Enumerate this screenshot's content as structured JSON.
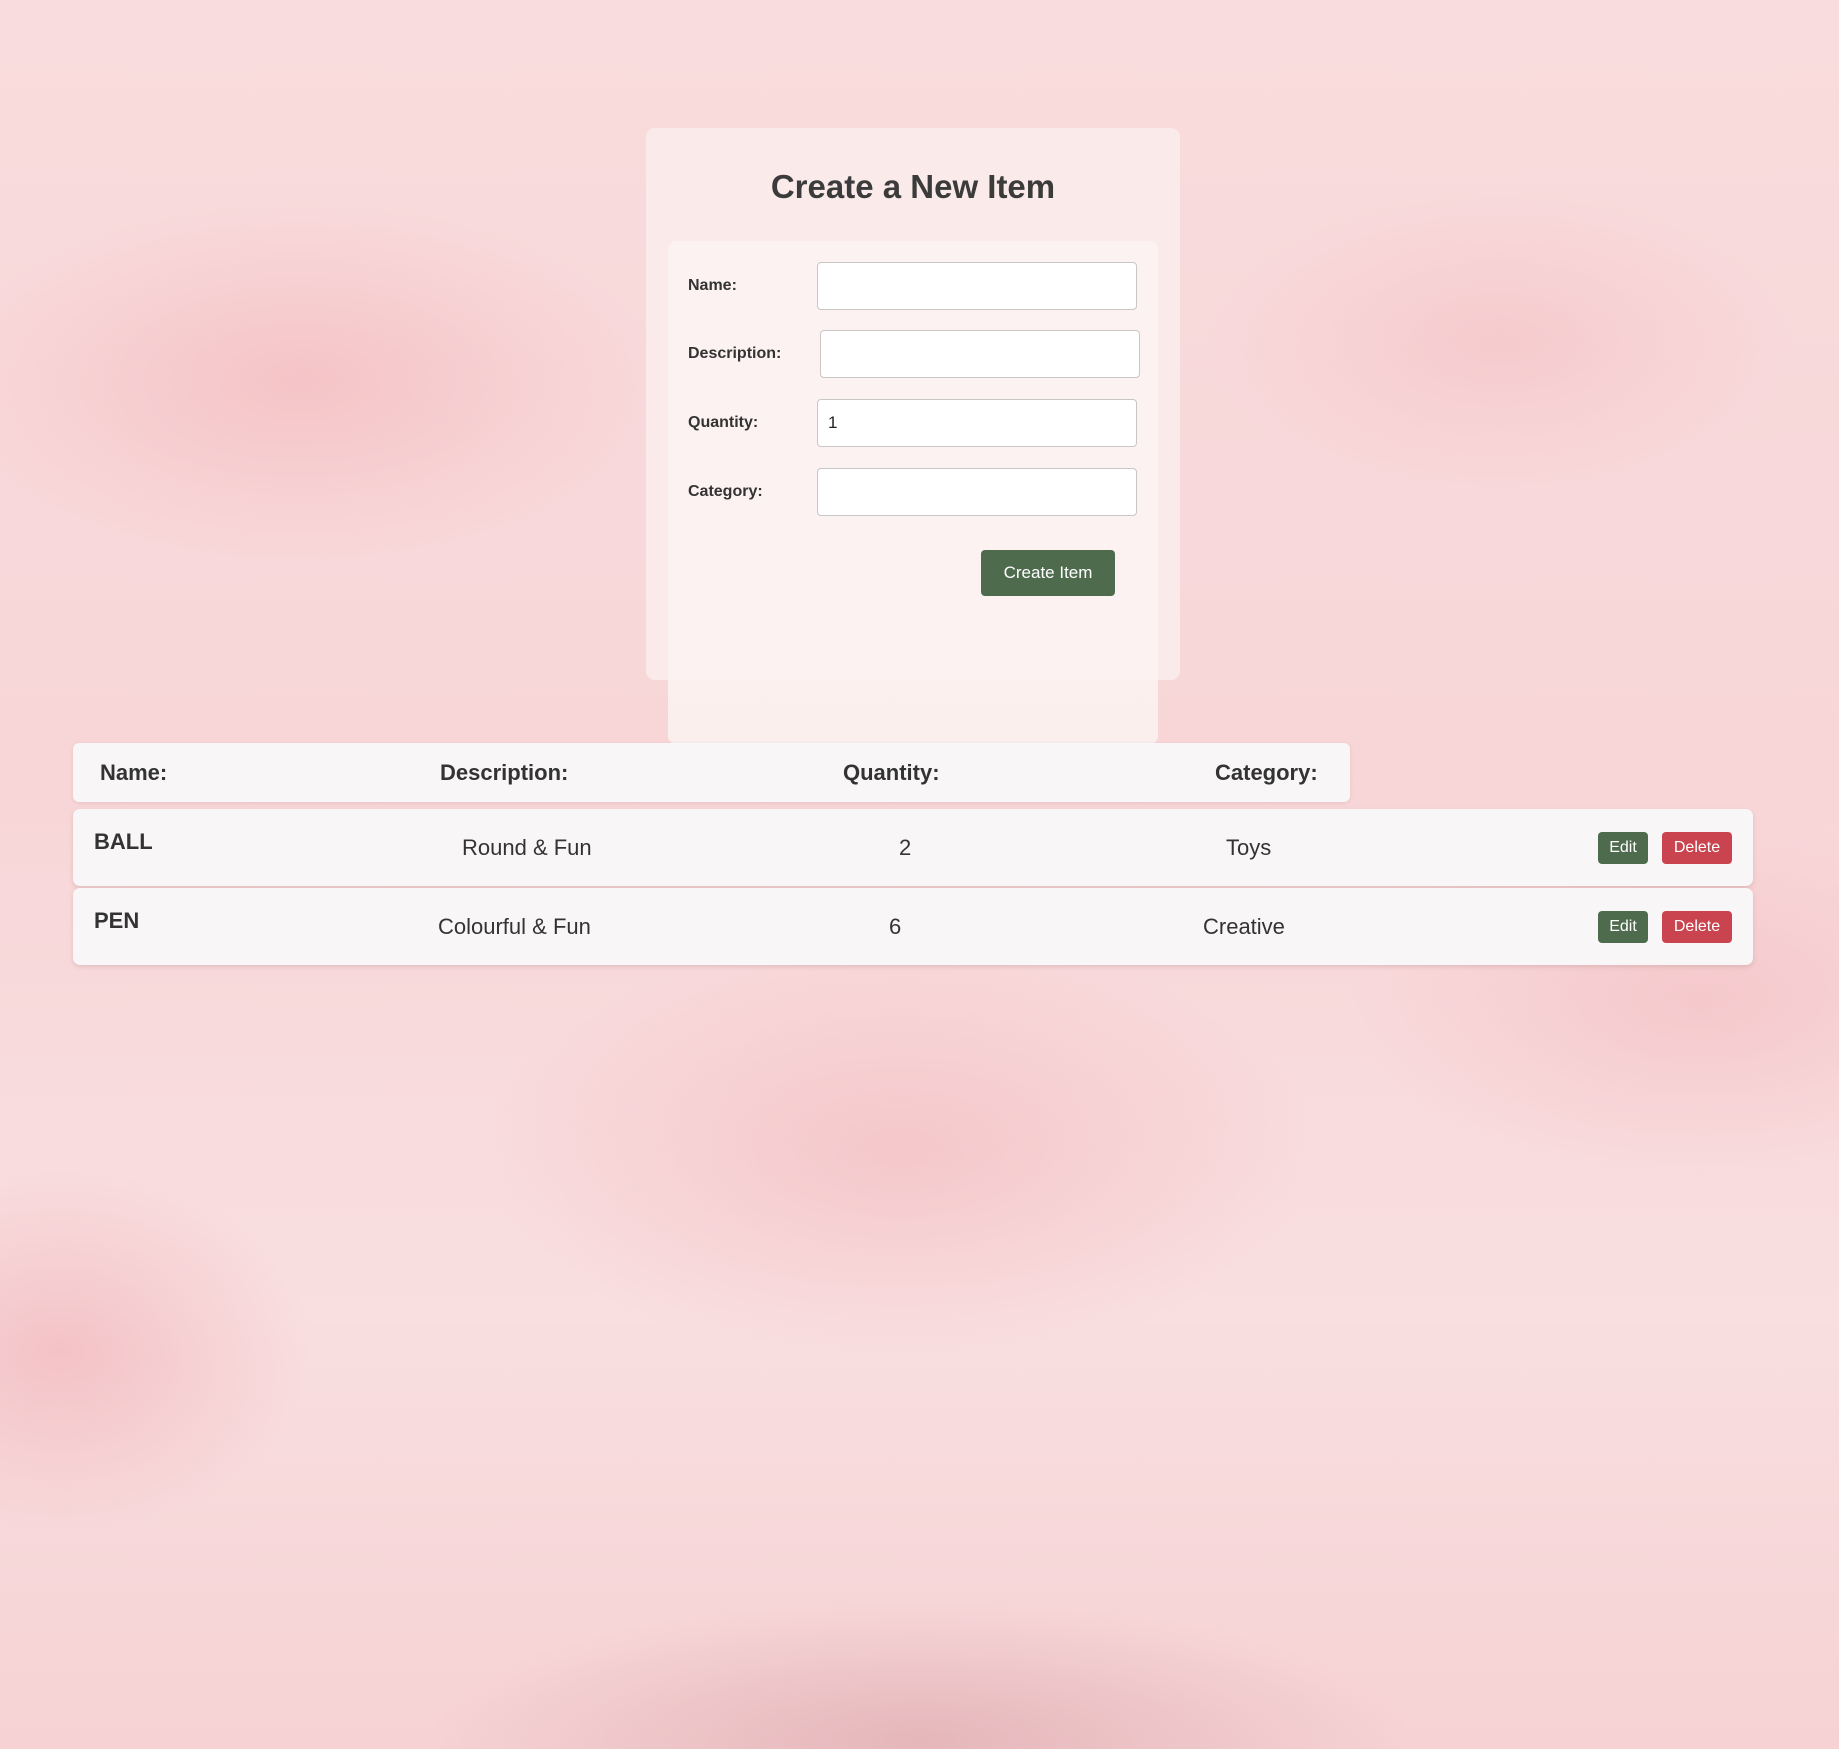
{
  "form": {
    "title": "Create a New Item",
    "fields": {
      "name": {
        "label": "Name:",
        "value": ""
      },
      "description": {
        "label": "Description:",
        "value": ""
      },
      "quantity": {
        "label": "Quantity:",
        "value": "1"
      },
      "category": {
        "label": "Category:",
        "value": ""
      }
    },
    "submit_label": "Create Item"
  },
  "table": {
    "headers": [
      "Name:",
      "Description:",
      "Quantity:",
      "Category:"
    ],
    "rows": [
      {
        "name": "BALL",
        "description": "Round & Fun",
        "quantity": "2",
        "category": "Toys",
        "edit_label": "Edit",
        "delete_label": "Delete"
      },
      {
        "name": "PEN",
        "description": "Colourful & Fun",
        "quantity": "6",
        "category": "Creative",
        "edit_label": "Edit",
        "delete_label": "Delete"
      }
    ]
  },
  "colors": {
    "primary_button": "#4e6b4e",
    "danger_button": "#c9444f",
    "background": "#f8d6d8"
  }
}
